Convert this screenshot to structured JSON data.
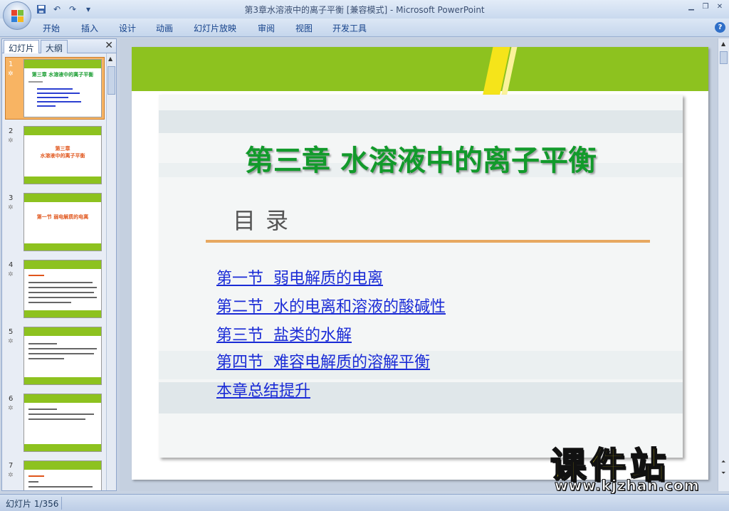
{
  "window": {
    "title": "第3章水溶液中的离子平衡 [兼容模式] - Microsoft PowerPoint"
  },
  "ribbon": {
    "tabs": [
      "开始",
      "插入",
      "设计",
      "动画",
      "幻灯片放映",
      "审阅",
      "视图",
      "开发工具"
    ]
  },
  "left_pane": {
    "tabs": [
      "幻灯片",
      "大纲"
    ],
    "slide_numbers": [
      "1",
      "2",
      "3",
      "4",
      "5",
      "6",
      "7"
    ],
    "thumb2_title_line1": "第三章",
    "thumb2_title_line2": "水溶液中的离子平衡",
    "thumb3_title": "第一节  弱电解质的电离",
    "thumb1_title": "第三章  水溶液中的离子平衡"
  },
  "slide": {
    "title": "第三章  水溶液中的离子平衡",
    "toc_heading": "目录",
    "links": [
      "第一节  弱电解质的电离",
      "第二节  水的电离和溶液的酸碱性",
      "第三节  盐类的水解",
      "第四节  难容电解质的溶解平衡",
      "本章总结提升"
    ]
  },
  "watermark": {
    "main": "课件站",
    "url": "www.kjzhan.com"
  },
  "status": {
    "slide_indicator": "幻灯片 1/356"
  },
  "colors": {
    "band_green": "#8dc21f",
    "title_green": "#129a2b",
    "link_blue": "#1a2bd6",
    "rule_orange": "#e7a861",
    "stripe_yellow": "#f5e41a"
  }
}
